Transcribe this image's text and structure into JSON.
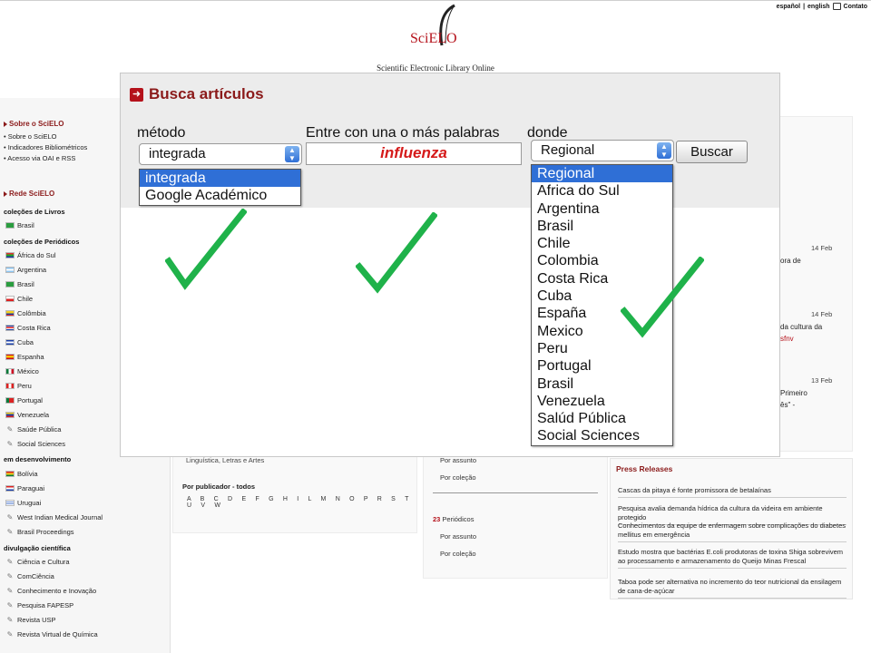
{
  "header": {
    "lang_es": "español",
    "lang_sep": "|",
    "lang_en": "english",
    "contact": "Contato",
    "logo_text": "SciELO",
    "logo_tagline": "Scientific Electronic Library Online"
  },
  "sidebar": {
    "sobre": {
      "title": "Sobre o SciELO",
      "links": [
        "• Sobre o SciELO",
        "• Indicadores Bibliométricos",
        "• Acesso via OAI e RSS"
      ]
    },
    "rede": {
      "title": "Rede SciELO",
      "livros_title": "coleções de Livros",
      "livros": [
        "Brasil"
      ],
      "periodicos_title": "coleções de Periódicos",
      "periodicos": [
        "África do Sul",
        "Argentina",
        "Brasil",
        "Chile",
        "Colômbia",
        "Costa Rica",
        "Cuba",
        "Espanha",
        "México",
        "Peru",
        "Portugal",
        "Venezuela",
        "Saúde Pública",
        "Social Sciences"
      ],
      "desenv_title": "em desenvolvimento",
      "desenv": [
        "Bolívia",
        "Paraguai",
        "Uruguai",
        "West Indian Medical Journal",
        "Brasil Proceedings"
      ],
      "divulg_title": "divulgação científica",
      "divulg": [
        "Ciência e Cultura",
        "ComCiência",
        "Conhecimento e Inovação",
        "Pesquisa FAPESP",
        "Revista USP",
        "Revista Virtual de Química"
      ]
    }
  },
  "main": {
    "area_link": "Linguística, Letras e Artes",
    "publisher_title": "Por publicador - todos",
    "alphabet": "A B C D E F G H I L M N O P R S T U V W",
    "by_subject": "Por assunto",
    "by_collection": "Por coleção",
    "periodicos_count": "23",
    "periodicos_label": " Periódicos",
    "news": [
      {
        "date": "14 Feb",
        "fragment": "ora de"
      },
      {
        "date": "14 Feb",
        "fragment": "da cultura da",
        "fragment2": "sfnv"
      },
      {
        "date": "13 Feb",
        "fragment": "Primeiro",
        "fragment2": "ês\" -"
      }
    ]
  },
  "press": {
    "title": "Press Releases",
    "items": [
      "Cascas da pitaya é fonte promissora de betalaínas",
      "Pesquisa avalia demanda hídrica da cultura da videira em ambiente protegido",
      "Conhecimentos da equipe de enfermagem sobre complicações do diabetes mellitus em emergência",
      "Estudo mostra que bactérias E.coli produtoras de toxina Shiga sobrevivem ao processamento e armazenamento do Queijo Minas Frescal",
      "Taboa pode ser alternativa no incremento do teor nutricional da ensilagem de cana-de-açúcar"
    ]
  },
  "search": {
    "title": "Busca artículos",
    "metodo_label": "método",
    "palabras_label": "Entre con una o más palabras",
    "donde_label": "donde",
    "metodo_value": "integrada",
    "metodo_options": [
      "integrada",
      "Google Académico"
    ],
    "query_value": "influenza",
    "donde_value": "Regional",
    "donde_options": [
      "Regional",
      "Africa do Sul",
      "Argentina",
      "Brasil",
      "Chile",
      "Colombia",
      "Costa Rica",
      "Cuba",
      "España",
      "Mexico",
      "Peru",
      "Portugal",
      "Brasil",
      "Venezuela",
      "Salúd Pública",
      "Social Sciences"
    ],
    "button_label": "Buscar"
  },
  "colors": {
    "brand_red": "#b5121b",
    "select_blue": "#2f6fd6",
    "check_green": "#1fb24a",
    "query_red": "#d51a1a"
  },
  "icons": [
    "arrow-right-icon",
    "chevron-updown-icon",
    "checkmark-icon",
    "envelope-icon",
    "flag-icon",
    "pen-icon"
  ]
}
